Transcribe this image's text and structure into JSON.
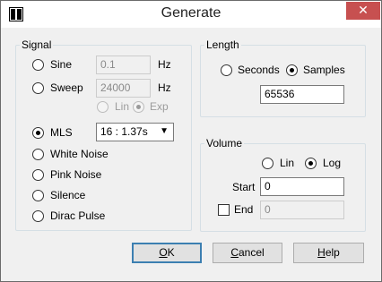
{
  "window": {
    "title": "Generate",
    "close_glyph": "✕"
  },
  "signal": {
    "legend": "Signal",
    "sine": {
      "label": "Sine",
      "value": "0.1",
      "unit": "Hz",
      "selected": false
    },
    "sweep": {
      "label": "Sweep",
      "value": "24000",
      "unit": "Hz",
      "selected": false
    },
    "sweep_scale": {
      "lin": "Lin",
      "exp": "Exp",
      "selected": "Exp"
    },
    "mls": {
      "label": "MLS",
      "selected": true,
      "option": "16 : 1.37s"
    },
    "white_noise": "White Noise",
    "pink_noise": "Pink Noise",
    "silence": "Silence",
    "dirac_pulse": "Dirac Pulse"
  },
  "length": {
    "legend": "Length",
    "seconds": "Seconds",
    "samples": "Samples",
    "selected": "Samples",
    "value": "65536"
  },
  "volume": {
    "legend": "Volume",
    "lin": "Lin",
    "log": "Log",
    "selected": "Log",
    "start_label": "Start",
    "start_value": "0",
    "end_label": "End",
    "end_checked": false,
    "end_value": "0"
  },
  "buttons": {
    "ok": {
      "prefix": "",
      "mnemonic": "O",
      "rest": "K"
    },
    "cancel": {
      "prefix": "",
      "mnemonic": "C",
      "rest": "ancel"
    },
    "help": {
      "prefix": "",
      "mnemonic": "H",
      "rest": "elp"
    }
  }
}
